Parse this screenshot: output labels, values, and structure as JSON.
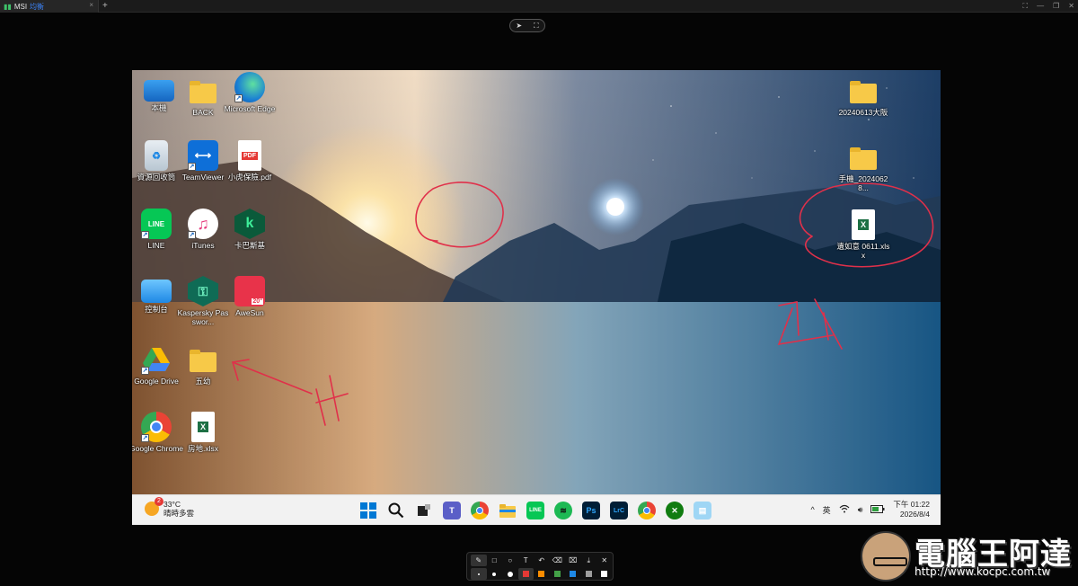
{
  "window": {
    "tab_title": "MSI",
    "tab_subtitle": "均衡",
    "tab_close": "×",
    "new_tab": "+",
    "controls": [
      "⛶",
      "—",
      "❐",
      "✕"
    ]
  },
  "float_toolbar": {
    "pointer_icon": "pointer-icon",
    "fullscreen_icon": "fullscreen-icon"
  },
  "desktop": {
    "icons_left": [
      {
        "label": "本機",
        "icon": "monitor-icon"
      },
      {
        "label": "BACK",
        "icon": "folder-icon"
      },
      {
        "label": "Microsoft Edge",
        "icon": "edge-icon"
      },
      {
        "label": "資源回收筒",
        "icon": "recycle-bin-icon"
      },
      {
        "label": "TeamViewer",
        "icon": "teamviewer-icon"
      },
      {
        "label": "小虎保險.pdf",
        "icon": "pdf-icon",
        "glyph": "PDF"
      },
      {
        "label": "LINE",
        "icon": "line-icon",
        "glyph": "LINE"
      },
      {
        "label": "iTunes",
        "icon": "itunes-icon",
        "glyph": "♫"
      },
      {
        "label": "卡巴斯基",
        "icon": "kaspersky-icon",
        "glyph": "k"
      },
      {
        "label": "控制台",
        "icon": "control-panel-icon"
      },
      {
        "label": "Kaspersky Passwor...",
        "icon": "kaspersky-password-icon"
      },
      {
        "label": "AweSun",
        "icon": "awesun-icon",
        "glyph": "20°"
      },
      {
        "label": "Google Drive",
        "icon": "google-drive-icon"
      },
      {
        "label": "五幼",
        "icon": "folder-icon"
      },
      {
        "label": "Google Chrome",
        "icon": "chrome-icon"
      },
      {
        "label": "房地.xlsx",
        "icon": "excel-icon"
      }
    ],
    "icons_right": [
      {
        "label": "20240613大阪",
        "icon": "folder-icon"
      },
      {
        "label": "手機_20240628...",
        "icon": "folder-icon"
      },
      {
        "label": "遺如意 0611.xlsx",
        "icon": "excel-icon"
      }
    ]
  },
  "taskbar": {
    "weather_badge": "2",
    "temperature": "33°C",
    "condition": "晴時多雲",
    "apps": [
      "windows-start-icon",
      "search-icon",
      "task-view-icon",
      "teams-icon",
      "chrome-icon",
      "file-explorer-icon",
      "line-icon",
      "spotify-icon",
      "photoshop-icon",
      "lightroom-icon",
      "chrome-profile-icon",
      "xbox-icon",
      "notepad-icon"
    ],
    "app_glyphs": {
      "photoshop": "Ps",
      "lightroom": "LrC"
    },
    "tray_caret": "^",
    "ime": "英",
    "time": "下午 01:22",
    "date": "2026/8/4"
  },
  "draw_toolbar": {
    "tools": [
      "pen-icon",
      "rectangle-icon",
      "circle-icon",
      "text-icon",
      "undo-icon",
      "eraser-icon",
      "delete-icon",
      "download-icon",
      "close-icon"
    ],
    "tool_glyphs": [
      "✎",
      "□",
      "○",
      "T",
      "↶",
      "⌫",
      "🗑",
      "⤓",
      "✕"
    ],
    "colors": [
      "#e53935",
      "#fb8c00",
      "#43a047",
      "#1e88e5",
      "#9e9e9e",
      "#ffffff"
    ]
  },
  "watermark": {
    "title": "電腦王阿達",
    "url": "http://www.kocpc.com.tw"
  }
}
